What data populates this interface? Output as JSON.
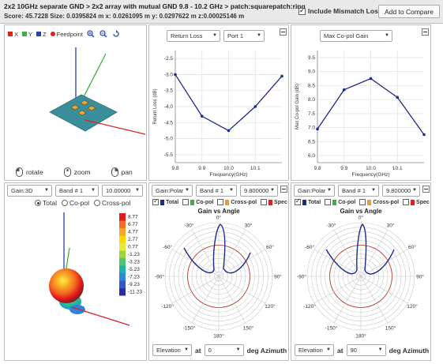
{
  "header": {
    "title": "2x2 10GHz separate GND > 2x2 array with mutual GND 9.8 - 10.2 GHz > patch:squarepatch:ring",
    "score_line": "Score: 45.7228  Size: 0.0395824 m   x: 0.0261095 m  y: 0.0297622 m  z:0.00025146 m",
    "include_mismatch_label": "Include Mismatch Loss",
    "include_mismatch_checked": true,
    "add_compare_label": "Add to Compare"
  },
  "view3d": {
    "legend": [
      {
        "label": "X",
        "color": "#e02020"
      },
      {
        "label": "Y",
        "color": "#3cb043"
      },
      {
        "label": "Z",
        "color": "#2a3fb5"
      },
      {
        "label": "Feedpoint",
        "color": "#e02020"
      }
    ],
    "tools": [
      "zoom-in-icon",
      "zoom-out-icon",
      "reset-icon"
    ],
    "controls": {
      "rotate": "rotate",
      "zoom": "zoom",
      "pan": "pan"
    }
  },
  "return_loss": {
    "metric_select": "Return Loss",
    "port_select": "Port 1",
    "chart_data": {
      "type": "line",
      "x": [
        9.8,
        9.9,
        10.0,
        10.1,
        10.2
      ],
      "values": [
        -3.0,
        -4.3,
        -4.75,
        -4.0,
        -3.05
      ],
      "xlabel": "Frequency(GHz)",
      "ylabel": "Return Loss (dB)",
      "xticks": [
        "9.8",
        "9.9",
        "10.0",
        "10.1"
      ],
      "yticks": [
        "-2.5",
        "-3.0",
        "-3.5",
        "-4.0",
        "-4.5",
        "-5.0",
        "-5.5"
      ],
      "xlim": [
        9.8,
        10.2
      ],
      "ylim": [
        -5.75,
        -2.25
      ],
      "grid": true,
      "line_color": "#1c2a8c"
    }
  },
  "max_gain": {
    "metric_select": "Max Co-pol Gain",
    "chart_data": {
      "type": "line",
      "x": [
        9.8,
        9.9,
        10.0,
        10.1,
        10.2
      ],
      "values": [
        6.95,
        8.35,
        8.75,
        8.08,
        6.75
      ],
      "xlabel": "Frequency(GHz)",
      "ylabel": "Max Co-pol Gain (dB)",
      "xticks": [
        "9.8",
        "9.9",
        "10.0",
        "10.1"
      ],
      "yticks": [
        "9.5",
        "9.0",
        "8.5",
        "8.0",
        "7.5",
        "7.0",
        "6.5",
        "6.0"
      ],
      "xlim": [
        9.8,
        10.2
      ],
      "ylim": [
        5.75,
        9.75
      ],
      "grid": true,
      "line_color": "#1c2a8c"
    }
  },
  "gain3d": {
    "gain_select": "Gain:3D",
    "band_select": "Band # 1",
    "freq_value": "10.00000",
    "radio": [
      {
        "label": "Total",
        "on": true
      },
      {
        "label": "Co-pol",
        "on": false
      },
      {
        "label": "Cross-pol",
        "on": false
      }
    ],
    "colorbar": [
      "8.77",
      "6.77",
      "4.77",
      "2.77",
      "0.77",
      "-1.23",
      "-3.23",
      "-5.23",
      "-7.23",
      "-9.23",
      "-11.23"
    ],
    "colorbar_colors": [
      "#e41a1c",
      "#f46d22",
      "#f9a825",
      "#ffd700",
      "#e6e93a",
      "#9bd63e",
      "#4cc86a",
      "#1fb3a8",
      "#2d87d9",
      "#3457c8",
      "#2a2f9c"
    ]
  },
  "polar_left": {
    "gain_select": "Gain:Polar",
    "band_select": "Band # 1",
    "freq_value": "9.800000",
    "checks": [
      {
        "label": "Total",
        "checked": true,
        "color": "#1c2a8c"
      },
      {
        "label": "Co-pol",
        "checked": false,
        "color": "#3cb043"
      },
      {
        "label": "Cross-pol",
        "checked": false,
        "color": "#f29b2c"
      },
      {
        "label": "Spec",
        "checked": false,
        "color": "#e02020"
      }
    ],
    "title": "Gain vs Angle",
    "angle_labels": {
      "top": "0°",
      "left": "-90°",
      "right": "90°",
      "bottom": "180°",
      "tl": "-30°",
      "tr": "30°",
      "bl": "-150°",
      "br": "150°",
      "ml": "-120°",
      "mr": "120°",
      "ul": "-60°",
      "ur": "60°"
    },
    "cut_select": "Elevation",
    "at_label": "at",
    "azimuth_value": "0",
    "deg_label": "deg Azimuth"
  },
  "polar_right": {
    "gain_select": "Gain:Polar",
    "band_select": "Band # 1",
    "freq_value": "9.800000",
    "checks": [
      {
        "label": "Total",
        "checked": true,
        "color": "#1c2a8c"
      },
      {
        "label": "Co-pol",
        "checked": false,
        "color": "#3cb043"
      },
      {
        "label": "Cross-pol",
        "checked": false,
        "color": "#f29b2c"
      },
      {
        "label": "Spec",
        "checked": false,
        "color": "#e02020"
      }
    ],
    "title": "Gain vs Angle",
    "angle_labels": {
      "top": "0°",
      "left": "-90°",
      "right": "90°",
      "bottom": "180°",
      "tl": "-30°",
      "tr": "30°",
      "bl": "-150°",
      "br": "150°",
      "ml": "-120°",
      "mr": "120°",
      "ul": "-60°",
      "ur": "60°"
    },
    "cut_select": "Elevation",
    "at_label": "at",
    "azimuth_value": "90",
    "deg_label": "deg Azimuth"
  }
}
